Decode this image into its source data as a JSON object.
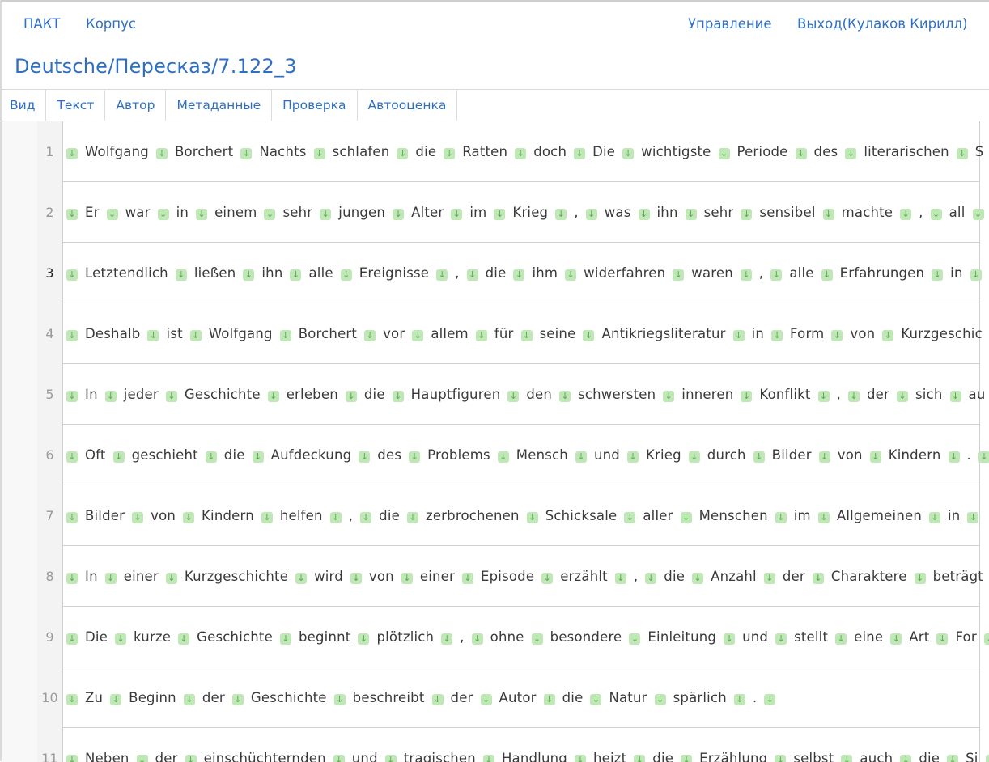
{
  "nav": {
    "left": [
      "ПАКТ",
      "Корпус"
    ],
    "right": [
      "Управление",
      "Выход(Кулаков Кирилл)"
    ]
  },
  "page_title": "Deutsche/Пересказ/7.122_3",
  "tabs": [
    "Вид",
    "Текст",
    "Автор",
    "Метаданные",
    "Проверка",
    "Автооценка"
  ],
  "separator_icon": "arrow-down-icon",
  "colors": {
    "link": "#2f6fc3",
    "separator_bg": "#bfe8b6",
    "separator_fg": "#5ea855"
  },
  "active_row": "3",
  "rows": [
    {
      "n": "1",
      "tokens": [
        "Wolfgang",
        "Borchert",
        "Nachts",
        "schlafen",
        "die",
        "Ratten",
        "doch",
        "Die",
        "wichtigste",
        "Periode",
        "des",
        "literarischen",
        "S"
      ]
    },
    {
      "n": "2",
      "tokens": [
        "Er",
        "war",
        "in",
        "einem",
        "sehr",
        "jungen",
        "Alter",
        "im",
        "Krieg",
        ",",
        "was",
        "ihn",
        "sehr",
        "sensibel",
        "machte",
        ",",
        "all"
      ]
    },
    {
      "n": "3",
      "tokens": [
        "Letztendlich",
        "ließen",
        "ihn",
        "alle",
        "Ereignisse",
        ",",
        "die",
        "ihm",
        "widerfahren",
        "waren",
        ",",
        "alle",
        "Erfahrungen",
        "in"
      ]
    },
    {
      "n": "4",
      "tokens": [
        "Deshalb",
        "ist",
        "Wolfgang",
        "Borchert",
        "vor",
        "allem",
        "für",
        "seine",
        "Antikriegsliteratur",
        "in",
        "Form",
        "von",
        "Kurzgeschic"
      ]
    },
    {
      "n": "5",
      "tokens": [
        "In",
        "jeder",
        "Geschichte",
        "erleben",
        "die",
        "Hauptfiguren",
        "den",
        "schwersten",
        "inneren",
        "Konflikt",
        ",",
        "der",
        "sich",
        "au"
      ]
    },
    {
      "n": "6",
      "tokens": [
        "Oft",
        "geschieht",
        "die",
        "Aufdeckung",
        "des",
        "Problems",
        "Mensch",
        "und",
        "Krieg",
        "durch",
        "Bilder",
        "von",
        "Kindern",
        "."
      ]
    },
    {
      "n": "7",
      "tokens": [
        "Bilder",
        "von",
        "Kindern",
        "helfen",
        ",",
        "die",
        "zerbrochenen",
        "Schicksale",
        "aller",
        "Menschen",
        "im",
        "Allgemeinen",
        "in"
      ]
    },
    {
      "n": "8",
      "tokens": [
        "In",
        "einer",
        "Kurzgeschichte",
        "wird",
        "von",
        "einer",
        "Episode",
        "erzählt",
        ",",
        "die",
        "Anzahl",
        "der",
        "Charaktere",
        "beträgt"
      ]
    },
    {
      "n": "9",
      "tokens": [
        "Die",
        "kurze",
        "Geschichte",
        "beginnt",
        "plötzlich",
        ",",
        "ohne",
        "besondere",
        "Einleitung",
        "und",
        "stellt",
        "eine",
        "Art",
        "For"
      ]
    },
    {
      "n": "10",
      "tokens": [
        "Zu",
        "Beginn",
        "der",
        "Geschichte",
        "beschreibt",
        "der",
        "Autor",
        "die",
        "Natur",
        "spärlich",
        "."
      ]
    },
    {
      "n": "11",
      "tokens": [
        "Neben",
        "der",
        "einschüchternden",
        "und",
        "tragischen",
        "Handlung",
        "heizt",
        "die",
        "Erzählung",
        "selbst",
        "auch",
        "die",
        "Si"
      ]
    }
  ]
}
